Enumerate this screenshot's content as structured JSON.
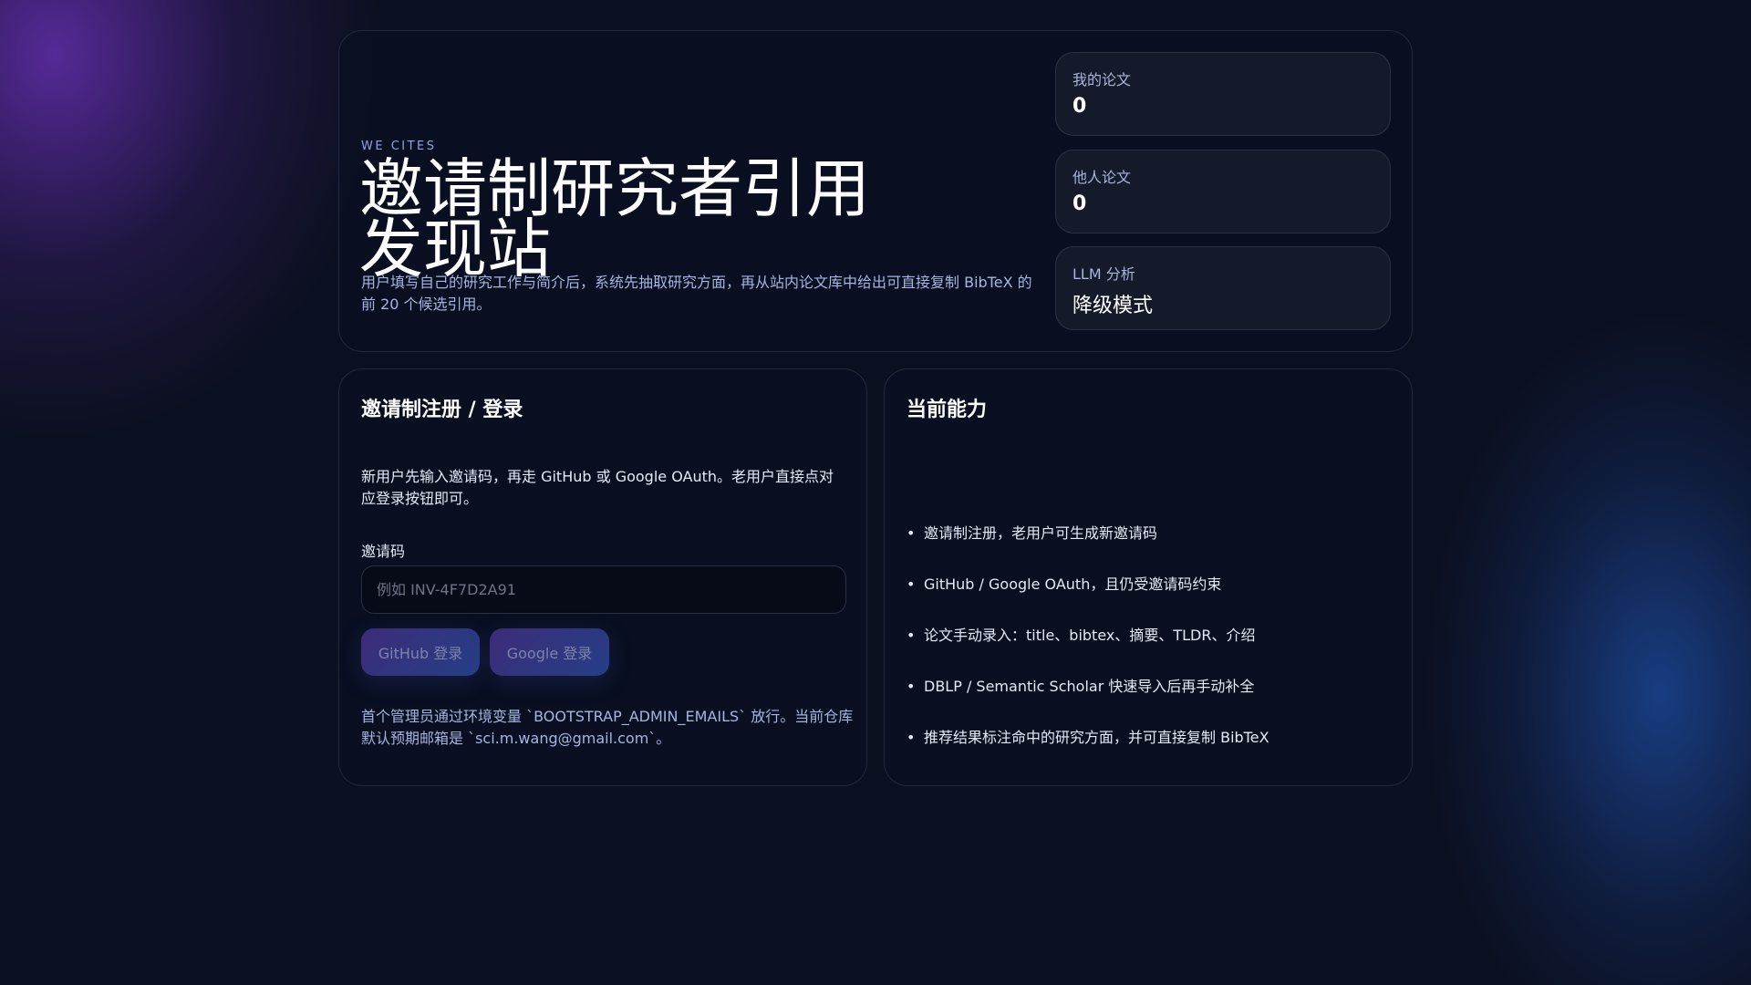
{
  "hero": {
    "eyebrow": "WE CITES",
    "title": "邀请制研究者引用发现站",
    "description": "用户填写自己的研究工作与简介后，系统先抽取研究方面，再从站内论文库中给出可直接复制 BibTeX 的前 20 个候选引用。"
  },
  "stats": [
    {
      "label": "我的论文",
      "value": "0"
    },
    {
      "label": "他人论文",
      "value": "0"
    },
    {
      "label": "LLM 分析",
      "value": "降级模式"
    }
  ],
  "auth": {
    "heading": "邀请制注册 / 登录",
    "intro": "新用户先输入邀请码，再走 GitHub 或 Google OAuth。老用户直接点对应登录按钮即可。",
    "field_label": "邀请码",
    "placeholder": "例如 INV-4F7D2A91",
    "github_label": "GitHub 登录",
    "google_label": "Google 登录",
    "note": "首个管理员通过环境变量 `BOOTSTRAP_ADMIN_EMAILS` 放行。当前仓库默认预期邮箱是 `sci.m.wang@gmail.com`。"
  },
  "capabilities": {
    "heading": "当前能力",
    "items": [
      "邀请制注册，老用户可生成新邀请码",
      "GitHub / Google OAuth，且仍受邀请码约束",
      "论文手动录入：title、bibtex、摘要、TLDR、介绍",
      "DBLP / Semantic Scholar 快速导入后再手动补全",
      "推荐结果标注命中的研究方面，并可直接复制 BibTeX"
    ]
  }
}
